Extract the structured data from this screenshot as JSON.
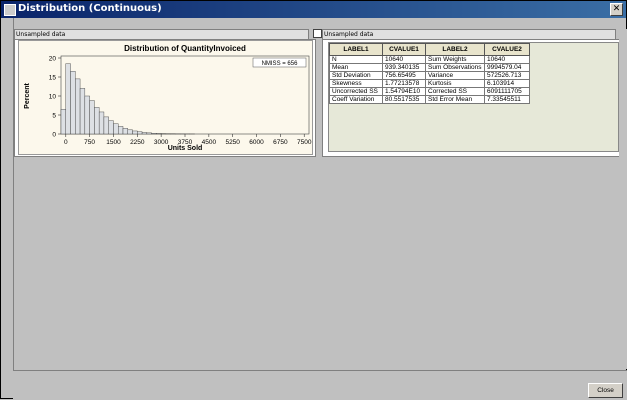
{
  "window": {
    "title": "Distribution (Continuous)",
    "close_glyph": "✕"
  },
  "left_pane": {
    "header": "Unsampled data"
  },
  "right_pane": {
    "header": "Unsampled data"
  },
  "chart_data": {
    "type": "bar",
    "title": "Distribution of QuantityInvoiced",
    "xlabel": "Units Sold",
    "ylabel": "Percent",
    "ylim": [
      0,
      20
    ],
    "yticks": [
      0,
      5,
      10,
      15,
      20
    ],
    "xlim": [
      -150,
      7650
    ],
    "xticks": [
      0,
      750,
      1500,
      2250,
      3000,
      3750,
      4500,
      5250,
      6000,
      6750,
      7500
    ],
    "bin_width": 150,
    "bin_starts": [
      -150,
      0,
      150,
      300,
      450,
      600,
      750,
      900,
      1050,
      1200,
      1350,
      1500,
      1650,
      1800,
      1950,
      2100,
      2250,
      2400,
      2550,
      2700,
      2850,
      3000,
      3150,
      3300,
      3450,
      3600,
      3750,
      3900
    ],
    "values": [
      6.5,
      18.5,
      16.5,
      14.5,
      12.0,
      10.0,
      8.8,
      7.0,
      5.8,
      4.5,
      3.5,
      2.7,
      2.0,
      1.5,
      1.1,
      0.8,
      0.6,
      0.4,
      0.3,
      0.2,
      0.15,
      0.1,
      0.08,
      0.06,
      0.05,
      0.04,
      0.03,
      0.02
    ],
    "inset_label": "NMISS = 656",
    "colors": {
      "bar_fill": "#dde0e4",
      "bar_stroke": "#333333",
      "background": "#fcf8ec"
    }
  },
  "stats": {
    "headers": [
      "LABEL1",
      "CVALUE1",
      "LABEL2",
      "CVALUE2"
    ],
    "rows": [
      [
        "N",
        "10640",
        "Sum Weights",
        "10640"
      ],
      [
        "Mean",
        "939.340135",
        "Sum Observations",
        "9994579.04"
      ],
      [
        "Std Deviation",
        "756.65495",
        "Variance",
        "572526.713"
      ],
      [
        "Skewness",
        "1.77213578",
        "Kurtosis",
        "6.103914"
      ],
      [
        "Uncorrected SS",
        "1.54794E10",
        "Corrected SS",
        "6091111705"
      ],
      [
        "Coeff Variation",
        "80.5517535",
        "Std Error Mean",
        "7.33545511"
      ]
    ]
  },
  "buttons": {
    "close": "Close"
  }
}
